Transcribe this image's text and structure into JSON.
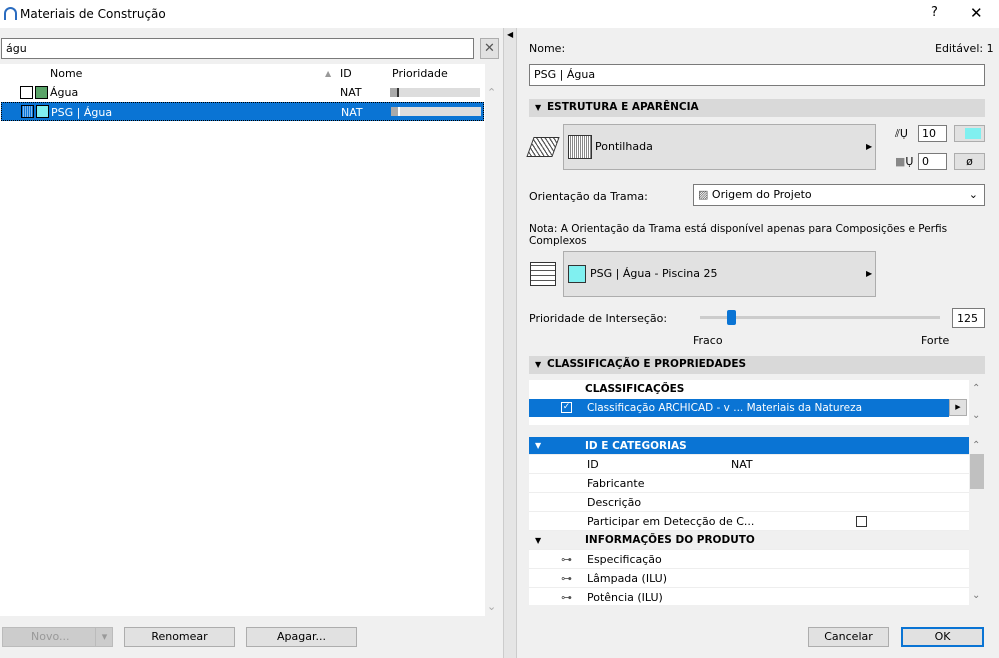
{
  "window": {
    "title": "Materiais de Construção",
    "help": "?",
    "close": "✕"
  },
  "left": {
    "search_value": "águ",
    "columns": {
      "name": "Nome",
      "id": "ID",
      "priority": "Prioridade"
    },
    "rows": [
      {
        "name": "Água",
        "id": "NAT",
        "priority": 0.05,
        "color": "#5aa469",
        "selected": false
      },
      {
        "name": "PSG | Água",
        "id": "NAT",
        "priority": 0.05,
        "color": "#80f0f0",
        "selected": true
      }
    ],
    "buttons": {
      "new": "Novo...",
      "rename": "Renomear",
      "delete": "Apagar..."
    }
  },
  "right": {
    "name_label": "Nome:",
    "editable": "Editável: 1",
    "name_value": "PSG | Água",
    "section1": "ESTRUTURA E APARÊNCIA",
    "fill_name": "Pontilhada",
    "pen1": "10",
    "pen2": "0",
    "no_bg": "ø",
    "orientation_label": "Orientação da Trama:",
    "orientation_value": "Origem do Projeto",
    "note": "Nota: A Orientação da Trama está disponível apenas para Composições e Perfis Complexos",
    "surface": "PSG | Água - Piscina 25",
    "surface_color": "#80f0f0",
    "priority_label": "Prioridade de Interseção:",
    "priority_value": "125",
    "priority_fraction": 0.13,
    "weak": "Fraco",
    "strong": "Forte",
    "section2": "CLASSIFICAÇÃO E PROPRIEDADES",
    "class_header": "CLASSIFICAÇÕES",
    "class_row": "Classificação ARCHICAD - v ... Materiais da Natureza",
    "props": {
      "group1": "ID E CATEGORIAS",
      "id_label": "ID",
      "id_value": "NAT",
      "fabricante": "Fabricante",
      "descricao": "Descrição",
      "participar": "Participar em Detecção de C...",
      "group2": "INFORMAÇÕES DO PRODUTO",
      "items": [
        "Especificação",
        "Lâmpada (ILU)",
        "Potência (ILU)"
      ]
    },
    "cancel": "Cancelar",
    "ok": "OK"
  }
}
